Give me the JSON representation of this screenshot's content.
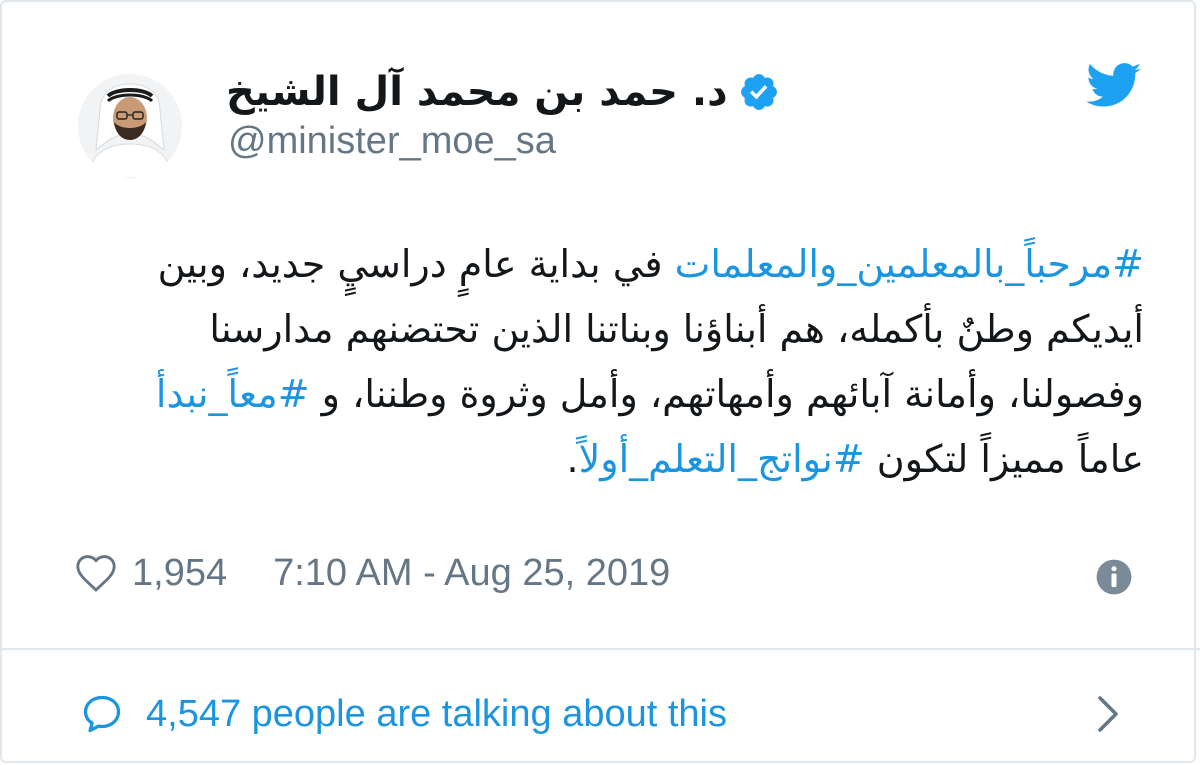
{
  "colors": {
    "accent": "#1b95e0",
    "twitter_blue": "#1da1f2",
    "muted": "#657786",
    "text": "#14171a",
    "border": "#e1e8ed"
  },
  "header": {
    "display_name": "د. حمد بن محمد آل الشيخ",
    "handle": "@minister_moe_sa",
    "avatar_icon": "profile-photo",
    "verified_icon": "verified-badge-icon",
    "brand_icon": "twitter-bird-icon"
  },
  "tweet": {
    "segments": [
      {
        "text": "#مرحباً_بالمعلمين_والمعلمات",
        "hashtag": true
      },
      {
        "text": " في بداية عامٍ دراسيٍ جديد، وبين أيديكم وطنٌ بأكمله، هم أبناؤنا وبناتنا الذين تحتضنهم مدارسنا وفصولنا، وأمانة آبائهم وأمهاتهم، وأمل وثروة وطننا، و ",
        "hashtag": false
      },
      {
        "text": "#معاً_نبدأ",
        "hashtag": true
      },
      {
        "text": " عاماً مميزاً لتكون ",
        "hashtag": false
      },
      {
        "text": "#نواتج_التعلم_أولاً",
        "hashtag": true
      },
      {
        "text": ".",
        "hashtag": false
      }
    ]
  },
  "meta": {
    "likes": "1,954",
    "timestamp": "7:10 AM - Aug 25, 2019",
    "heart_icon": "heart-icon",
    "info_icon": "info-icon"
  },
  "footer": {
    "talking_text": "4,547 people are talking about this",
    "bubble_icon": "speech-bubble-icon",
    "chevron_icon": "chevron-right-icon"
  }
}
